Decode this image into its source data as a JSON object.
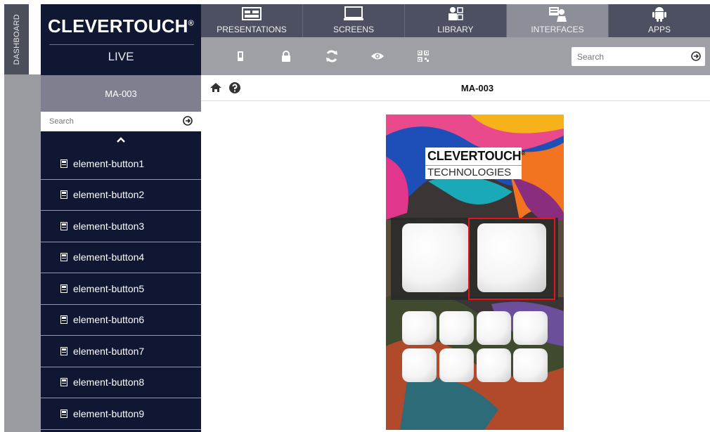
{
  "dashboard": {
    "label": "DASHBOARD"
  },
  "brand": {
    "name": "CLEVERTOUCH",
    "reg": "®",
    "sub": "LIVE"
  },
  "tabs": [
    {
      "label": "PRESENTATIONS",
      "icon": "presentation-icon",
      "active": false
    },
    {
      "label": "SCREENS",
      "icon": "monitor-icon",
      "active": false
    },
    {
      "label": "LIBRARY",
      "icon": "library-icon",
      "active": false
    },
    {
      "label": "INTERFACES",
      "icon": "interface-icon",
      "active": true
    },
    {
      "label": "APPS",
      "icon": "android-icon",
      "active": false
    }
  ],
  "toolbar": {
    "icons": [
      "device-icon",
      "lock-icon",
      "refresh-icon",
      "eye-icon",
      "qr-code-icon"
    ],
    "search_placeholder": "Search"
  },
  "panel": {
    "title": "MA-003",
    "search_placeholder": "Search",
    "items": [
      "element-button1",
      "element-button2",
      "element-button3",
      "element-button4",
      "element-button5",
      "element-button6",
      "element-button7",
      "element-button8",
      "element-button9"
    ]
  },
  "content": {
    "title": "MA-003"
  },
  "preview": {
    "logo_top": "CLEVERTOUCH",
    "logo_reg": "®",
    "logo_bottom": "TECHNOLOGIES"
  },
  "colors": {
    "navy": "#0f1733",
    "tab_bg": "#4d5060",
    "tab_active": "#8d8f98",
    "toolbar": "#9fa0a6",
    "highlight": "#e2161b"
  }
}
